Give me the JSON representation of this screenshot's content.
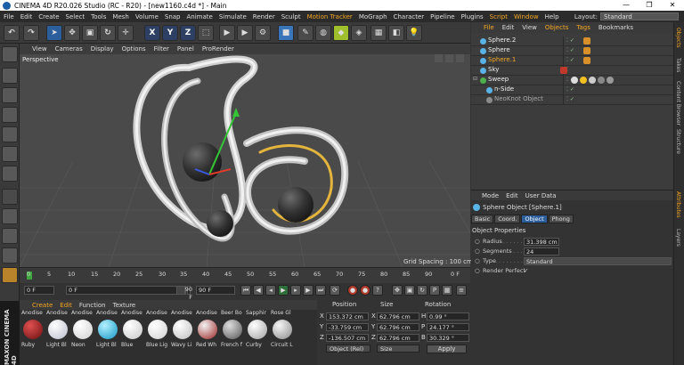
{
  "window": {
    "title": "CINEMA 4D R20.026 Studio (RC - R20) - [new1160.c4d *] - Main",
    "controls": [
      "—",
      "❐",
      "✕"
    ]
  },
  "menubar": {
    "items": [
      "File",
      "Edit",
      "Create",
      "Select",
      "Tools",
      "Mesh",
      "Volume",
      "Snap",
      "Animate",
      "Simulate",
      "Render",
      "Sculpt",
      "Motion Tracker",
      "MoGraph",
      "Character",
      "Pipeline",
      "Plugins",
      "Script",
      "Window",
      "Help"
    ],
    "highlighted": [
      "Motion Tracker",
      "Script",
      "Window"
    ],
    "layout_label": "Layout:",
    "layout_value": "Standard"
  },
  "toolbar": {
    "undo_icon": "undo-icon",
    "x_label": "X",
    "y_label": "Y",
    "z_label": "Z"
  },
  "viewport": {
    "menu": [
      "View",
      "Cameras",
      "Display",
      "Options",
      "Filter",
      "Panel",
      "ProRender"
    ],
    "camera_label": "Perspective",
    "grid_spacing": "Grid Spacing : 100 cm"
  },
  "timeline": {
    "ticks": [
      "0",
      "5",
      "10",
      "15",
      "20",
      "25",
      "30",
      "35",
      "40",
      "45",
      "50",
      "55",
      "60",
      "65",
      "70",
      "75",
      "80",
      "85",
      "90"
    ],
    "current_frame": "0 F",
    "start_frame": "0 F",
    "end_frame": "90 F",
    "max_frame": "90 F",
    "frame_end_field": "0 F"
  },
  "materials": {
    "menu": [
      "Create",
      "Edit",
      "Function",
      "Texture"
    ],
    "items": [
      {
        "top": "Anodise",
        "bottom": "Ruby",
        "color": "#8b1a1a"
      },
      {
        "top": "Anodise",
        "bottom": "Light Bl",
        "color": "#e8e8ef"
      },
      {
        "top": "Anodise",
        "bottom": "Neon",
        "color": "#f4f4f4"
      },
      {
        "top": "Anodise",
        "bottom": "Light Bl",
        "color": "#36c7ec"
      },
      {
        "top": "Anodise",
        "bottom": "Blue",
        "color": "#f0f0f0"
      },
      {
        "top": "Anodise",
        "bottom": "Blue Lig",
        "color": "#f2f2f2"
      },
      {
        "top": "Anodise",
        "bottom": "Wavy Li",
        "color": "#e9e9e9"
      },
      {
        "top": "Anodise",
        "bottom": "Red Wh",
        "color": "#d2d2d2"
      },
      {
        "top": "Beer Bo",
        "bottom": "French f",
        "color": "#9a9a9a"
      },
      {
        "top": "Sapphir",
        "bottom": "Curby",
        "color": "#d9d9d9"
      },
      {
        "top": "Rose Gl",
        "bottom": "Circuit L",
        "color": "#c9c9c9"
      }
    ]
  },
  "coordinates": {
    "headers": [
      "Position",
      "Size",
      "Rotation"
    ],
    "rows": [
      {
        "axis": "X",
        "position": "153.372 cm",
        "size_axis": "X",
        "size": "62.796 cm",
        "rot_axis": "H",
        "rotation": "0.99 °"
      },
      {
        "axis": "Y",
        "position": "-33.759 cm",
        "size_axis": "Y",
        "size": "62.796 cm",
        "rot_axis": "P",
        "rotation": "24.177 °"
      },
      {
        "axis": "Z",
        "position": "-136.507 cm",
        "size_axis": "Z",
        "size": "62.796 cm",
        "rot_axis": "B",
        "rotation": "30.329 °"
      }
    ],
    "mode": "Object (Rel)",
    "size_mode": "Size",
    "apply": "Apply"
  },
  "object_manager": {
    "menu": [
      "File",
      "Edit",
      "View",
      "Objects",
      "Tags",
      "Bookmarks"
    ],
    "highlighted": [
      "File",
      "Objects",
      "Tags"
    ],
    "objects": [
      {
        "name": "Sphere.2",
        "indent": 0,
        "icon_color": "#5ab2e6"
      },
      {
        "name": "Sphere",
        "indent": 0,
        "icon_color": "#5ab2e6"
      },
      {
        "name": "Sphere.1",
        "indent": 0,
        "icon_color": "#5ab2e6",
        "selected": true
      },
      {
        "name": "Sky",
        "indent": 0,
        "icon_color": "#5ab2e6"
      },
      {
        "name": "Sweep",
        "indent": 0,
        "icon_color": "#4db04b"
      },
      {
        "name": "n-Side",
        "indent": 1,
        "icon_color": "#5ab2e6"
      },
      {
        "name": "NeoKnot Object",
        "indent": 1,
        "icon_color": "#8a8a8a"
      }
    ]
  },
  "attribute_manager": {
    "menu": [
      "Mode",
      "Edit",
      "User Data"
    ],
    "title": "Sphere Object [Sphere.1]",
    "tabs": [
      "Basic",
      "Coord.",
      "Object",
      "Phong"
    ],
    "active_tab": "Object",
    "section": "Object Properties",
    "props": [
      {
        "label": "Radius",
        "value": "31.398 cm"
      },
      {
        "label": "Segments",
        "value": "24"
      },
      {
        "label": "Type",
        "value": "Standard"
      },
      {
        "label": "Render Perfect",
        "value": "✓"
      }
    ]
  },
  "side_tabs": [
    "Objects",
    "Takes",
    "Content Browser",
    "Structure",
    "Attributes",
    "Layers"
  ],
  "brand": "MAXON CINEMA 4D"
}
